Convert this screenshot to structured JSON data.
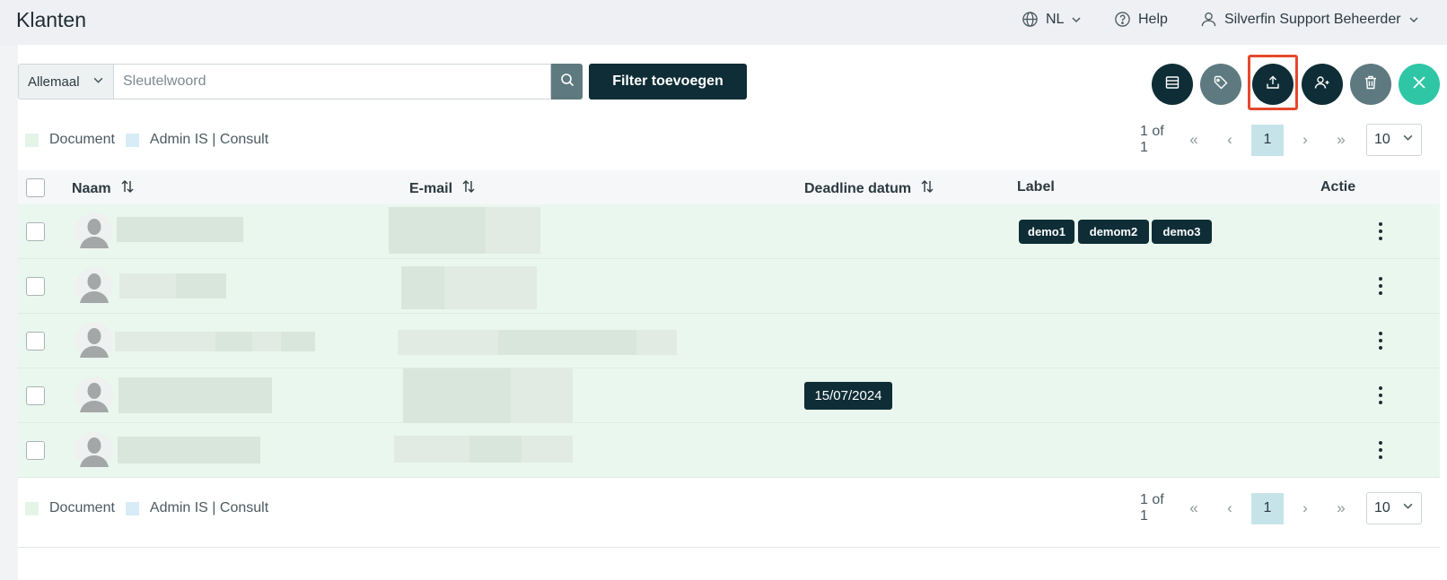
{
  "app": {
    "title": "Klanten"
  },
  "topnav": {
    "language": "NL",
    "help": "Help",
    "user": "Silverfin Support Beheerder"
  },
  "toolbar": {
    "scope_value": "Allemaal",
    "search_placeholder": "Sleutelwoord",
    "filter_label": "Filter toevoegen",
    "actions": [
      "table-view-icon",
      "tag-icon",
      "upload-icon",
      "add-user-icon",
      "trash-icon",
      "close-icon"
    ]
  },
  "legend": {
    "document": "Document",
    "admin": "Admin IS | Consult"
  },
  "pagination": {
    "info": "1 of 1",
    "first": "«",
    "prev": "‹",
    "current_page": "1",
    "next": "›",
    "last": "»",
    "page_size": "10"
  },
  "table": {
    "columns": {
      "name": "Naam",
      "email": "E-mail",
      "deadline": "Deadline datum",
      "label": "Label",
      "action": "Actie"
    },
    "rows": [
      {
        "labels": [
          "demo1",
          "demom2",
          "demo3"
        ],
        "deadline": ""
      },
      {
        "labels": [],
        "deadline": ""
      },
      {
        "labels": [],
        "deadline": ""
      },
      {
        "labels": [],
        "deadline": "15/07/2024"
      },
      {
        "labels": [],
        "deadline": ""
      }
    ]
  },
  "colors": {
    "primary": "#0e2d36",
    "row_background": "#eaf7ee",
    "legend_document": "#e4f5e8",
    "legend_admin": "#d6ecf7",
    "highlight": "#e5482c",
    "close_button": "#2fc6a6"
  }
}
